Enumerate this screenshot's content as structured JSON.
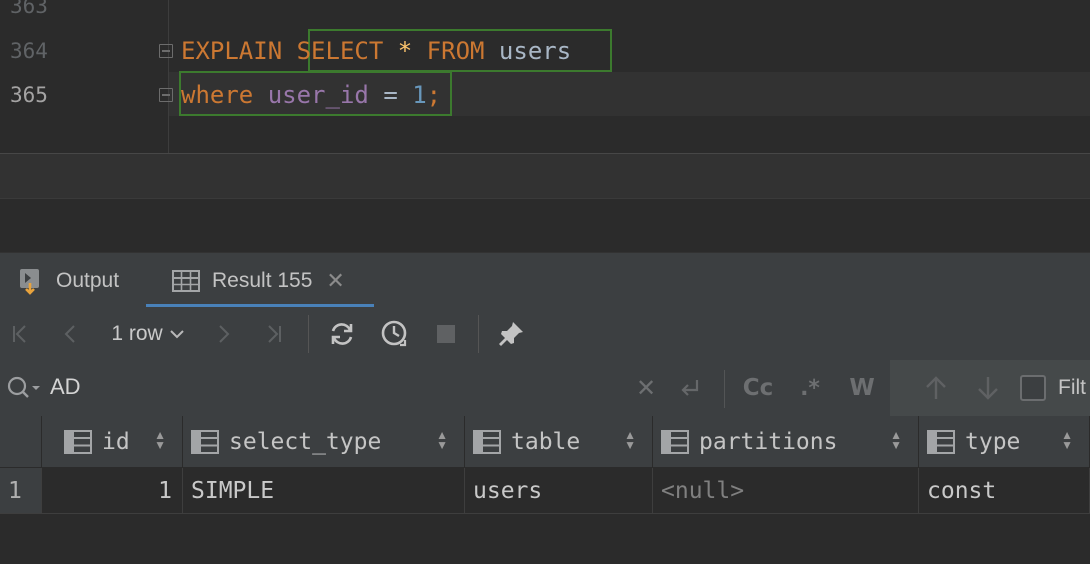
{
  "editor": {
    "line_numbers": [
      "363",
      "364",
      "365"
    ],
    "line1": {
      "kw1": "EXPLAIN",
      "kw2": "SELECT",
      "star": "*",
      "kw3": "FROM",
      "table": "users"
    },
    "line2": {
      "kw1": "where",
      "column": "user_id",
      "op": "=",
      "num": "1",
      "semi": ";"
    }
  },
  "tabs": [
    {
      "label": "Output",
      "active": false
    },
    {
      "label": "Result 155",
      "active": true
    }
  ],
  "toolbar": {
    "row_count": "1 row"
  },
  "search": {
    "value": "AD",
    "case_label": "Cc",
    "regex_label": ".*",
    "word_label": "W",
    "filter_label": "Filt"
  },
  "grid": {
    "columns": [
      "id",
      "select_type",
      "table",
      "partitions",
      "type"
    ],
    "rows": [
      {
        "row_num": "1",
        "cells": [
          "1",
          "SIMPLE",
          "users",
          "<null>",
          "const"
        ]
      }
    ]
  },
  "colors": {
    "keyword": "#cc7832",
    "identifier": "#a9b7c6",
    "column": "#9876aa",
    "number": "#6897bb",
    "match_border": "#3c7a2e",
    "tab_accent": "#4a88c7"
  }
}
